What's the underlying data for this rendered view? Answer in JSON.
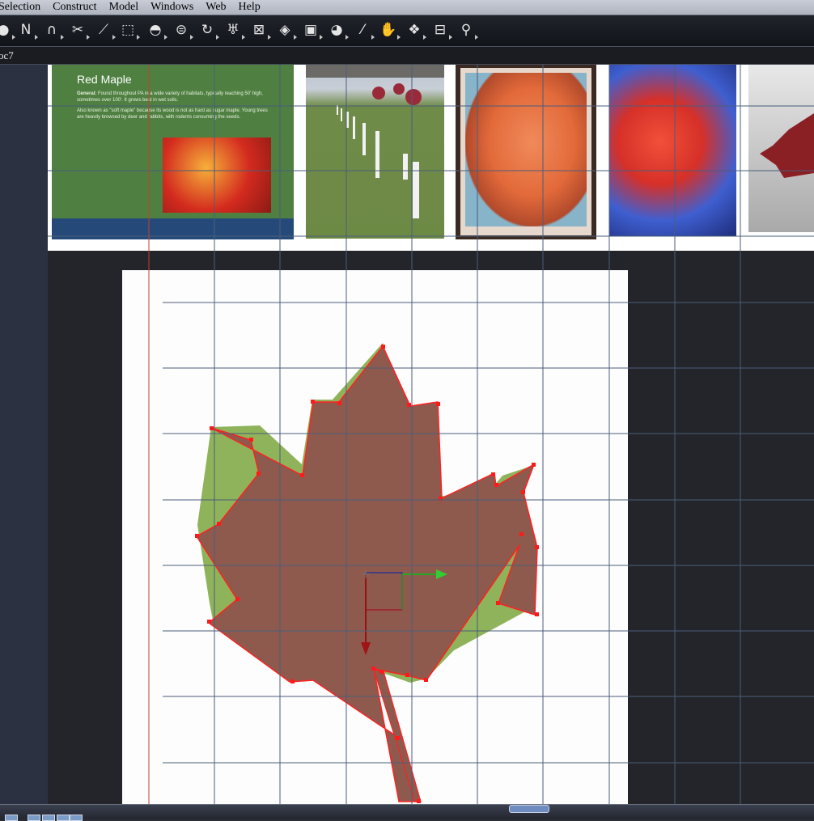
{
  "menu": [
    "Selection",
    "Construct",
    "Model",
    "Windows",
    "Web",
    "Help"
  ],
  "toolbar_icons": [
    "sphere-tool-icon",
    "polyline-tool-icon",
    "magnet-tool-icon",
    "scissors-tool-icon",
    "point-tool-icon",
    "bounding-box-tool-icon",
    "half-sphere-tool-icon",
    "lathe-tool-icon",
    "rotate-object-icon",
    "goblet-tool-icon",
    "x-box-tool-icon",
    "box-tool-icon",
    "bag-tool-icon",
    "ball-tool-icon",
    "pen-tool-icon",
    "hand-tool-icon",
    "unfold-tool-icon",
    "camera-tool-icon",
    "pin-tool-icon"
  ],
  "document": {
    "tab_label": "oc7"
  },
  "thumbnails": {
    "slide_title": "Red Maple",
    "slide_body_label": "General:",
    "slide_body_1": "Found throughout PA in a wide variety of habitats, typically reaching 50' high, sometimes over 100'. It grows best in wet soils.",
    "slide_body_2": "Also known as \"soft maple\" because its wood is not as hard as sugar maple. Young trees are heavily browsed by deer and rabbits, with rodents consuming the seeds."
  },
  "colors": {
    "leaf_fill": "#8f5a4e",
    "leaf_outline": "#ff2020",
    "leaf_edge": "#7fa84a",
    "grid_line": "#4a5d7a",
    "guide_line": "#c44030",
    "slide_green": "#4f8042"
  }
}
